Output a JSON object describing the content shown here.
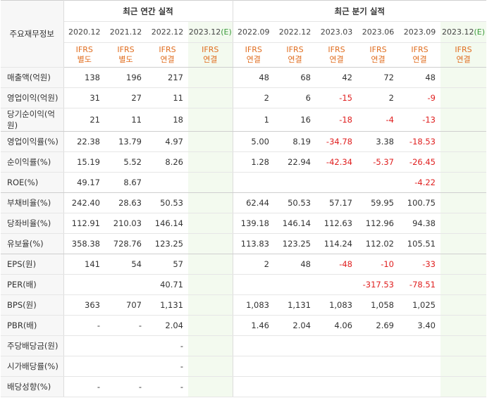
{
  "header": {
    "row_label": "주요재무정보",
    "annual_title": "최근 연간 실적",
    "quarter_title": "최근 분기 실적",
    "annual_periods": [
      "2020.12",
      "2021.12",
      "2022.12",
      "2023.12"
    ],
    "annual_estimate_mark": "(E)",
    "quarter_periods": [
      "2022.09",
      "2022.12",
      "2023.03",
      "2023.06",
      "2023.09",
      "2023.12"
    ],
    "quarter_estimate_mark": "(E)",
    "annual_formats": [
      [
        "IFRS",
        "별도"
      ],
      [
        "IFRS",
        "별도"
      ],
      [
        "IFRS",
        "연결"
      ],
      [
        "IFRS",
        "연결"
      ]
    ],
    "quarter_formats": [
      [
        "IFRS",
        "연결"
      ],
      [
        "IFRS",
        "연결"
      ],
      [
        "IFRS",
        "연결"
      ],
      [
        "IFRS",
        "연결"
      ],
      [
        "IFRS",
        "연결"
      ],
      [
        "IFRS",
        "연결"
      ]
    ]
  },
  "rows": [
    {
      "label": "매출액(억원)",
      "annual": [
        "138",
        "196",
        "217",
        ""
      ],
      "quarter": [
        "48",
        "68",
        "42",
        "72",
        "48",
        ""
      ]
    },
    {
      "label": "영업이익(억원)",
      "annual": [
        "31",
        "27",
        "11",
        ""
      ],
      "quarter": [
        "2",
        "6",
        "-15",
        "2",
        "-9",
        ""
      ]
    },
    {
      "label": "당기순이익(억원)",
      "annual": [
        "21",
        "11",
        "18",
        ""
      ],
      "quarter": [
        "1",
        "16",
        "-18",
        "-4",
        "-13",
        ""
      ]
    },
    {
      "label": "영업이익률(%)",
      "annual": [
        "22.38",
        "13.79",
        "4.97",
        ""
      ],
      "quarter": [
        "5.00",
        "8.19",
        "-34.78",
        "3.38",
        "-18.53",
        ""
      ]
    },
    {
      "label": "순이익률(%)",
      "annual": [
        "15.19",
        "5.52",
        "8.26",
        ""
      ],
      "quarter": [
        "1.28",
        "22.94",
        "-42.34",
        "-5.37",
        "-26.45",
        ""
      ]
    },
    {
      "label": "ROE(%)",
      "annual": [
        "49.17",
        "8.67",
        "",
        ""
      ],
      "quarter": [
        "",
        "",
        "",
        "",
        "-4.22",
        ""
      ]
    },
    {
      "label": "부채비율(%)",
      "annual": [
        "242.40",
        "28.63",
        "50.53",
        ""
      ],
      "quarter": [
        "62.44",
        "50.53",
        "57.17",
        "59.95",
        "100.75",
        ""
      ]
    },
    {
      "label": "당좌비율(%)",
      "annual": [
        "112.91",
        "210.03",
        "146.14",
        ""
      ],
      "quarter": [
        "139.18",
        "146.14",
        "112.63",
        "112.96",
        "94.38",
        ""
      ]
    },
    {
      "label": "유보율(%)",
      "annual": [
        "358.38",
        "728.76",
        "123.25",
        ""
      ],
      "quarter": [
        "113.83",
        "123.25",
        "114.24",
        "112.02",
        "105.51",
        ""
      ]
    },
    {
      "label": "EPS(원)",
      "annual": [
        "141",
        "54",
        "57",
        ""
      ],
      "quarter": [
        "2",
        "48",
        "-48",
        "-10",
        "-33",
        ""
      ]
    },
    {
      "label": "PER(배)",
      "annual": [
        "",
        "",
        "40.71",
        ""
      ],
      "quarter": [
        "",
        "",
        "",
        "-317.53",
        "-78.51",
        ""
      ]
    },
    {
      "label": "BPS(원)",
      "annual": [
        "363",
        "707",
        "1,131",
        ""
      ],
      "quarter": [
        "1,083",
        "1,131",
        "1,083",
        "1,058",
        "1,025",
        ""
      ]
    },
    {
      "label": "PBR(배)",
      "annual": [
        "-",
        "-",
        "2.04",
        ""
      ],
      "quarter": [
        "1.46",
        "2.04",
        "4.06",
        "2.69",
        "3.40",
        ""
      ]
    },
    {
      "label": "주당배당금(원)",
      "annual": [
        "",
        "",
        "-",
        ""
      ],
      "quarter": [
        "",
        "",
        "",
        "",
        "",
        ""
      ]
    },
    {
      "label": "시가배당률(%)",
      "annual": [
        "",
        "",
        "-",
        ""
      ],
      "quarter": [
        "",
        "",
        "",
        "",
        "",
        ""
      ]
    },
    {
      "label": "배당성향(%)",
      "annual": [
        "-",
        "-",
        "-",
        ""
      ],
      "quarter": [
        "",
        "",
        "",
        "",
        "",
        ""
      ]
    }
  ],
  "section_breaks_after": [
    2,
    5,
    8
  ]
}
